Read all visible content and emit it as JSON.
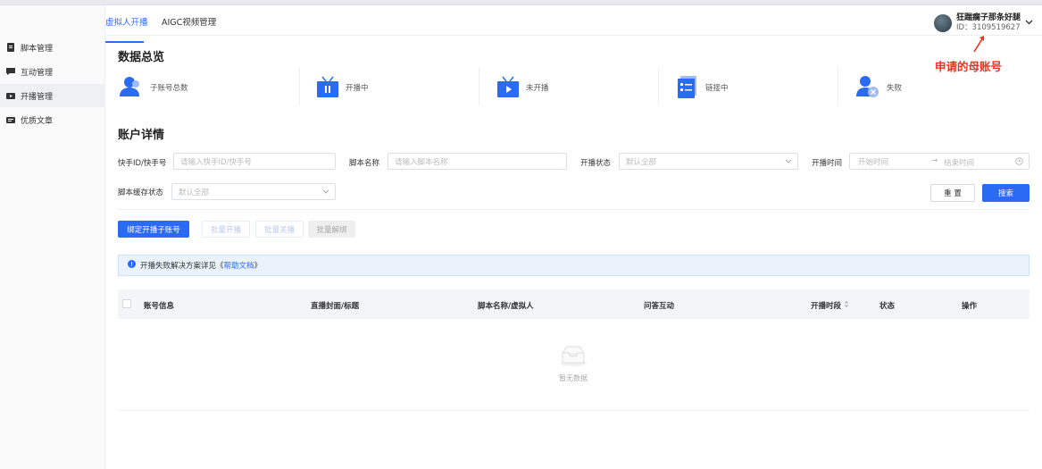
{
  "header": {
    "tabs": [
      {
        "label": "虚拟人开播",
        "active": true
      },
      {
        "label": "AIGC视频管理",
        "active": false
      }
    ],
    "user": {
      "name": "狂踹瘸子那条好腿",
      "id": "ID：3109519627"
    }
  },
  "annotation": "申请的母账号",
  "sidebar": {
    "items": [
      {
        "label": "脚本管理",
        "icon": "document-icon"
      },
      {
        "label": "互动管理",
        "icon": "chat-icon"
      },
      {
        "label": "开播管理",
        "icon": "video-icon",
        "active": true
      },
      {
        "label": "优质文章",
        "icon": "article-icon"
      }
    ]
  },
  "overview": {
    "title": "数据总览",
    "stats": [
      {
        "label": "子账号总数",
        "icon": "users-icon"
      },
      {
        "label": "开播中",
        "icon": "tv-pause-icon"
      },
      {
        "label": "未开播",
        "icon": "tv-play-icon"
      },
      {
        "label": "链接中",
        "icon": "checklist-icon"
      },
      {
        "label": "失败",
        "icon": "user-error-icon"
      }
    ]
  },
  "details": {
    "title": "账户详情",
    "filters": {
      "account_label": "快手ID/快手号",
      "account_placeholder": "请输入快手ID/快手号",
      "script_label": "脚本名称",
      "script_placeholder": "请输入脚本名称",
      "status_label": "开播状态",
      "status_value": "默认全部",
      "time_label": "开播时间",
      "time_start": "开始时间",
      "time_end": "结束时间",
      "cache_label": "脚本缓存状态",
      "cache_value": "默认全部"
    },
    "buttons": {
      "reset": "重 置",
      "search": "搜索",
      "bind": "绑定开播子账号",
      "batch_start": "批量开播",
      "batch_stop": "批量关播",
      "batch_unbind": "批量解绑"
    },
    "notice": {
      "text": "开播失败解决方案详见《",
      "link": "帮助文档",
      "suffix": "》"
    },
    "table": {
      "columns": [
        "账号信息",
        "直播封面/标题",
        "脚本名称/虚拟人",
        "问答互动",
        "开播时段",
        "状态",
        "操作"
      ],
      "empty_text": "暂无数据"
    }
  },
  "colors": {
    "primary": "#2b6af3",
    "annotation": "#f2301b"
  }
}
